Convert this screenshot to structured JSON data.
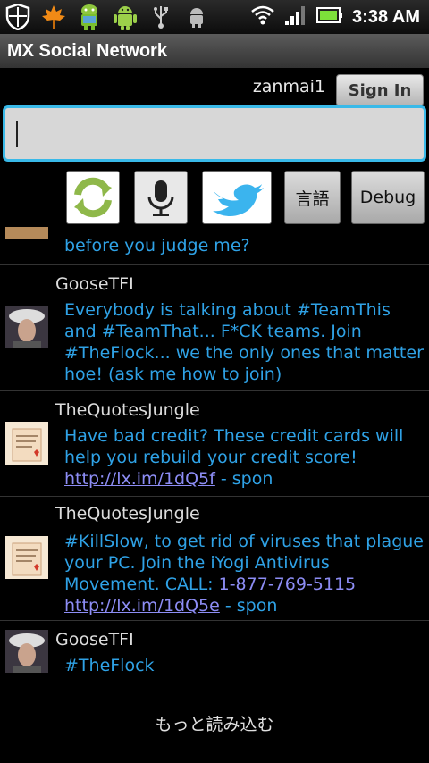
{
  "status_bar": {
    "time": "3:38 AM",
    "icons_left": [
      "shield-icon",
      "maple-leaf-icon",
      "android-robot-icon",
      "android-icon",
      "usb-icon",
      "android-small-icon"
    ],
    "icons_right": [
      "wifi-icon",
      "signal-icon",
      "battery-icon"
    ]
  },
  "app": {
    "title": "MX Social Network"
  },
  "account": {
    "username": "zanmai1",
    "sign_in_label": "Sign In"
  },
  "compose": {
    "value": ""
  },
  "toolbar": {
    "lang_label": "言語",
    "debug_label": "Debug"
  },
  "feed": {
    "partial_item": {
      "text": "before you judge me?"
    },
    "items": [
      {
        "author": "GooseTFI",
        "text": "Everybody is talking about #TeamThis and #TeamThat... F*CK teams. Join #TheFlock... we the only ones that matter hoe! (ask me how to join)"
      },
      {
        "author": "TheQuotesJungle",
        "text_before": "Have bad credit? These credit cards will help you rebuild your credit score! ",
        "link1": "http://lx.im/1dQ5f",
        "text_after": " - spon"
      },
      {
        "author": "TheQuotesJungle",
        "text_before": "#KillSlow, to get rid of viruses that plague your PC. Join the iYogi Antivirus Movement. CALL: ",
        "link1": "1-877-769-5115",
        "link2": "http://lx.im/1dQ5e",
        "text_after": "- spon"
      },
      {
        "author": "GooseTFI",
        "text": "#TheFlock"
      }
    ]
  },
  "load_more_label": "もっと読み込む"
}
